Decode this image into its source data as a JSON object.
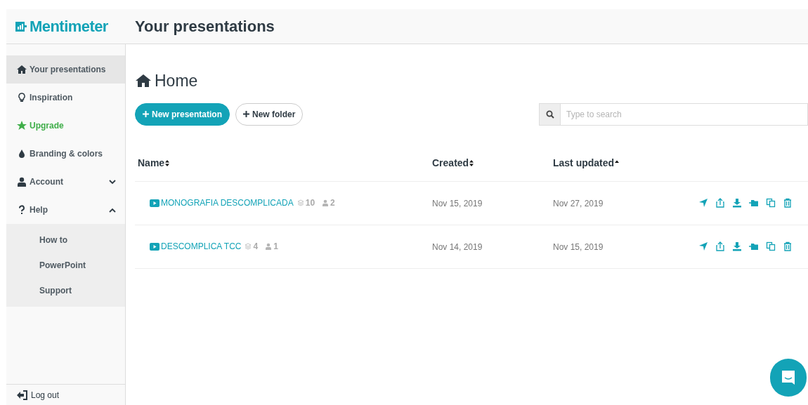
{
  "brand": {
    "name": "Mentimeter"
  },
  "header": {
    "title": "Your presentations"
  },
  "sidebar": {
    "items": [
      {
        "label": "Your presentations",
        "selected": true
      },
      {
        "label": "Inspiration",
        "selected": false
      },
      {
        "label": "Upgrade",
        "selected": false,
        "kind": "upgrade"
      },
      {
        "label": "Branding & colors",
        "selected": false
      },
      {
        "label": "Account",
        "selected": false,
        "expanded": false
      },
      {
        "label": "Help",
        "selected": false,
        "expanded": true,
        "children": [
          {
            "label": "How to"
          },
          {
            "label": "PowerPoint"
          },
          {
            "label": "Support"
          }
        ]
      }
    ],
    "footer": "Log out"
  },
  "page_title": "Home",
  "buttons": [
    {
      "label": "New presentation",
      "kind": "primary"
    },
    {
      "label": "New folder",
      "kind": "secondary"
    }
  ],
  "search": {
    "placeholder": "Type to search"
  },
  "table": {
    "columns": [
      {
        "label": "Name",
        "sorted": false
      },
      {
        "label": "Created",
        "sorted": false
      },
      {
        "label": "Last updated",
        "sorted": true
      }
    ],
    "rows": [
      {
        "name": "MONOGRAFIA DESCOMPLICADA",
        "slides": "10",
        "participants": "2",
        "created": "Nov 15, 2019",
        "updated": "Nov 27, 2019"
      },
      {
        "name": "DESCOMPLICA TCC",
        "slides": "4",
        "participants": "1",
        "created": "Nov 14, 2019",
        "updated": "Nov 15, 2019"
      }
    ]
  }
}
